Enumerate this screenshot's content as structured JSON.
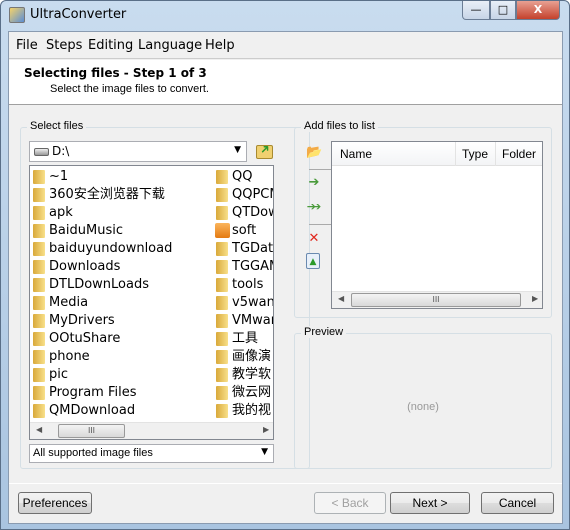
{
  "window": {
    "title": "UltraConverter",
    "minimize": "—",
    "maximize": "□",
    "close": "X"
  },
  "menu": [
    "File",
    "Steps",
    "Editing",
    "Language",
    "Help"
  ],
  "header": {
    "title": "Selecting files - Step 1 of 3",
    "subtitle": "Select the image files to convert."
  },
  "select_files": {
    "label": "Select files",
    "drive": "D:\\",
    "column1": [
      "~1",
      "360安全浏览器下载",
      "apk",
      "BaiduMusic",
      "baiduyundownload",
      "Downloads",
      "DTLDownLoads",
      "Media",
      "MyDrivers",
      "OOtuShare",
      "phone",
      "pic",
      "Program Files",
      "QMDownload"
    ],
    "column2": [
      "QQ",
      "QQPCM",
      "QTDow",
      "soft",
      "TGData",
      "TGGAM",
      "tools",
      "v5wan",
      "VMwar",
      "工具",
      "画像演",
      "教学软",
      "微云网",
      "我的视"
    ],
    "filter": "All supported image files"
  },
  "add_files": {
    "label": "Add files to list",
    "columns": [
      "Name",
      "Type",
      "Folder"
    ]
  },
  "preview": {
    "label": "Preview",
    "empty_text": "(none)"
  },
  "buttons": {
    "preferences": "Preferences",
    "back": "< Back",
    "next": "Next >",
    "cancel": "Cancel"
  }
}
